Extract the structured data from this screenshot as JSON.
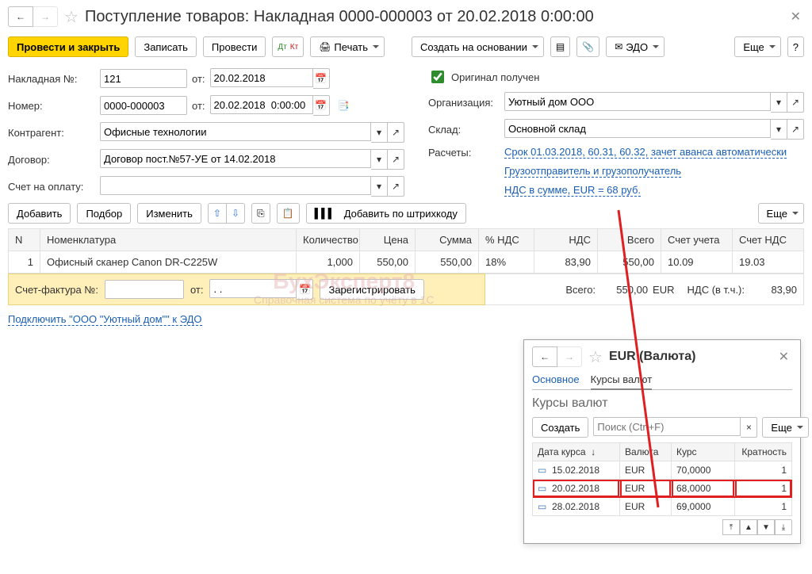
{
  "header": {
    "title": "Поступление товаров: Накладная 0000-000003 от 20.02.2018 0:00:00"
  },
  "toolbar": {
    "post_and_close": "Провести и закрыть",
    "save": "Записать",
    "post": "Провести",
    "print": "Печать",
    "create_based_on": "Создать на основании",
    "edo": "ЭДО",
    "more": "Еще",
    "help": "?"
  },
  "form": {
    "invoice_no_label": "Накладная №:",
    "invoice_no": "121",
    "from_label": "от:",
    "invoice_date": "20.02.2018",
    "number_label": "Номер:",
    "number": "0000-000003",
    "number_date": "20.02.2018  0:00:00",
    "counterparty_label": "Контрагент:",
    "counterparty": "Офисные технологии",
    "contract_label": "Договор:",
    "contract": "Договор пост.№57-УЕ от 14.02.2018",
    "payment_account_label": "Счет на оплату:",
    "payment_account": "",
    "original_received_label": "Оригинал получен",
    "organization_label": "Организация:",
    "organization": "Уютный дом ООО",
    "warehouse_label": "Склад:",
    "warehouse": "Основной склад",
    "settlements_label": "Расчеты:",
    "settlements_link": "Срок 01.03.2018, 60.31, 60.32, зачет аванса автоматически",
    "shipper_link": "Грузоотправитель и грузополучатель",
    "vat_link": "НДС в сумме, EUR = 68 руб."
  },
  "grid_toolbar": {
    "add": "Добавить",
    "select": "Подбор",
    "change": "Изменить",
    "add_by_barcode": "Добавить по штрихкоду",
    "more": "Еще"
  },
  "grid": {
    "columns": [
      "N",
      "Номенклатура",
      "Количество",
      "Цена",
      "Сумма",
      "% НДС",
      "НДС",
      "Всего",
      "Счет учета",
      "Счет НДС"
    ],
    "rows": [
      {
        "n": "1",
        "item": "Офисный сканер Canon DR-C225W",
        "qty": "1,000",
        "price": "550,00",
        "sum": "550,00",
        "vat_pct": "18%",
        "vat": "83,90",
        "total": "550,00",
        "acct": "10.09",
        "vat_acct": "19.03"
      }
    ]
  },
  "footer": {
    "sf_label": "Счет-фактура №:",
    "sf_no": "",
    "sf_from": "от:",
    "sf_date": ". .",
    "register": "Зарегистрировать",
    "total_label": "Всего:",
    "total_value": "550,00",
    "currency": "EUR",
    "vat_label": "НДС (в т.ч.):",
    "vat_value": "83,90",
    "edo_link": "Подключить \"ООО \"Уютный дом\"\" к ЭДО"
  },
  "watermark_top": "БухЭксперт8",
  "watermark_sub": "Справочная система по учёту в 1С",
  "popup": {
    "title": "EUR (Валюта)",
    "tabs": {
      "main": "Основное",
      "rates": "Курсы валют"
    },
    "heading": "Курсы валют",
    "create": "Создать",
    "search_placeholder": "Поиск (Ctrl+F)",
    "more": "Еще",
    "help": "?",
    "columns": [
      "Дата курса",
      "Валюта",
      "Курс",
      "Кратность"
    ],
    "rows": [
      {
        "date": "15.02.2018",
        "cur": "EUR",
        "rate": "70,0000",
        "mul": "1"
      },
      {
        "date": "20.02.2018",
        "cur": "EUR",
        "rate": "68,0000",
        "mul": "1"
      },
      {
        "date": "28.02.2018",
        "cur": "EUR",
        "rate": "69,0000",
        "mul": "1"
      }
    ],
    "highlight_index": 1
  }
}
